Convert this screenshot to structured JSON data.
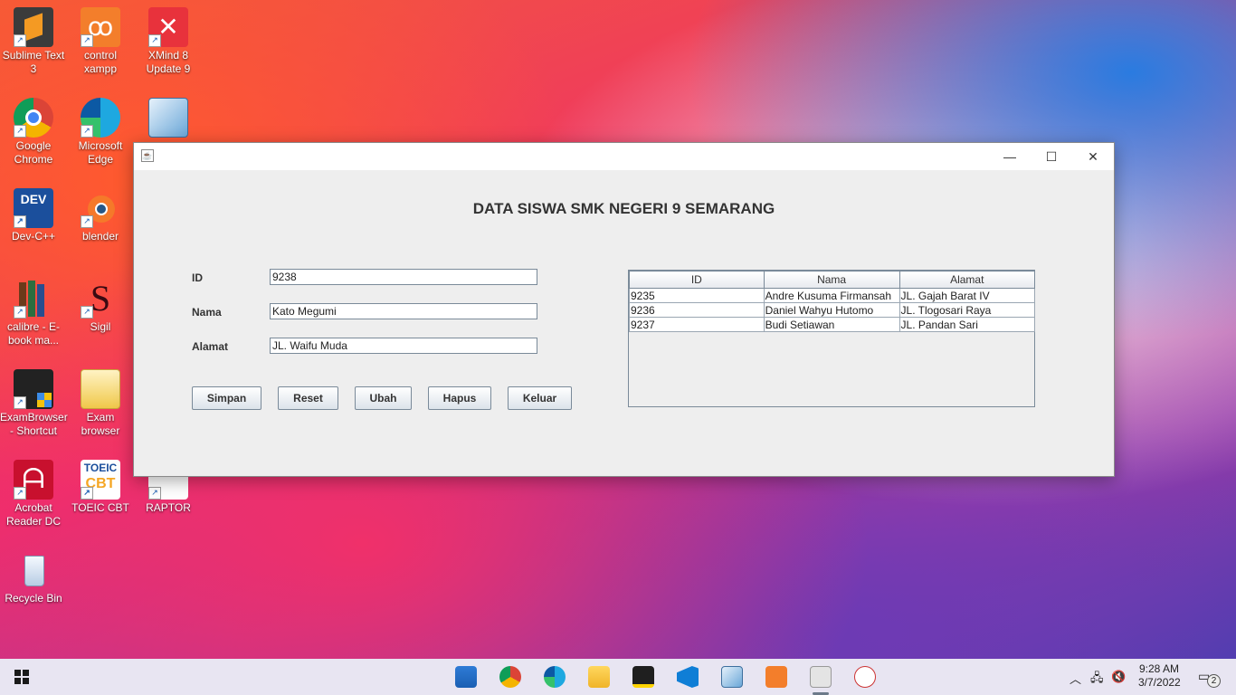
{
  "desktop": {
    "icons": [
      {
        "label": "Sublime Text 3"
      },
      {
        "label": "control xampp"
      },
      {
        "label": "XMind 8 Update 9"
      },
      {
        "label": "Google Chrome"
      },
      {
        "label": "Microsoft Edge"
      },
      {
        "label": "Dev-C++"
      },
      {
        "label": "blender"
      },
      {
        "label": "calibre - E-book ma..."
      },
      {
        "label": "Sigil"
      },
      {
        "label": "ExamBrowser - Shortcut"
      },
      {
        "label": "Exam browser"
      },
      {
        "label": "Acrobat Reader DC"
      },
      {
        "label": "TOEIC CBT"
      },
      {
        "label": "RAPTOR"
      },
      {
        "label": "Recycle Bin"
      }
    ]
  },
  "window": {
    "heading": "DATA SISWA SMK NEGERI 9 SEMARANG",
    "controls": {
      "minimize": "—",
      "maximize": "☐",
      "close": "✕"
    },
    "form": {
      "id_label": "ID",
      "id_value": "9238",
      "nama_label": "Nama",
      "nama_value": "Kato Megumi",
      "alamat_label": "Alamat",
      "alamat_value": "JL. Waifu Muda"
    },
    "buttons": {
      "simpan": "Simpan",
      "reset": "Reset",
      "ubah": "Ubah",
      "hapus": "Hapus",
      "keluar": "Keluar"
    },
    "table": {
      "columns": [
        "ID",
        "Nama",
        "Alamat"
      ],
      "rows": [
        [
          "9235",
          "Andre Kusuma Firmansah",
          "JL. Gajah Barat IV"
        ],
        [
          "9236",
          "Daniel Wahyu Hutomo",
          "JL. Tlogosari Raya"
        ],
        [
          "9237",
          "Budi Setiawan",
          "JL. Pandan Sari"
        ]
      ]
    }
  },
  "taskbar": {
    "time": "9:28 AM",
    "date": "3/7/2022",
    "notification_count": "2"
  }
}
